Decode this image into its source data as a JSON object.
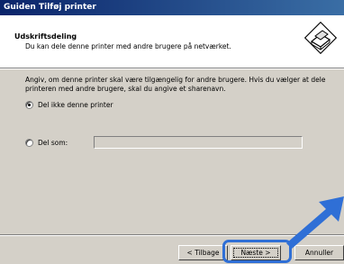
{
  "window": {
    "title": "Guiden Tilføj printer"
  },
  "header": {
    "title": "Udskriftsdeling",
    "subtitle": "Du kan dele denne printer med andre brugere på netværket."
  },
  "body": {
    "instruction": "Angiv, om denne printer skal være tilgængelig for andre brugere. Hvis du vælger at dele printeren med andre brugere, skal du angive et sharenavn."
  },
  "options": [
    {
      "label": "Del ikke denne printer",
      "selected": true
    },
    {
      "label": "Del som:",
      "selected": false
    }
  ],
  "share_name": {
    "value": ""
  },
  "buttons": {
    "back": "< Tilbage",
    "next": "Næste >",
    "cancel": "Annuller"
  },
  "colors": {
    "highlight": "#2f6fd6",
    "titlebar": "#0a246a"
  }
}
